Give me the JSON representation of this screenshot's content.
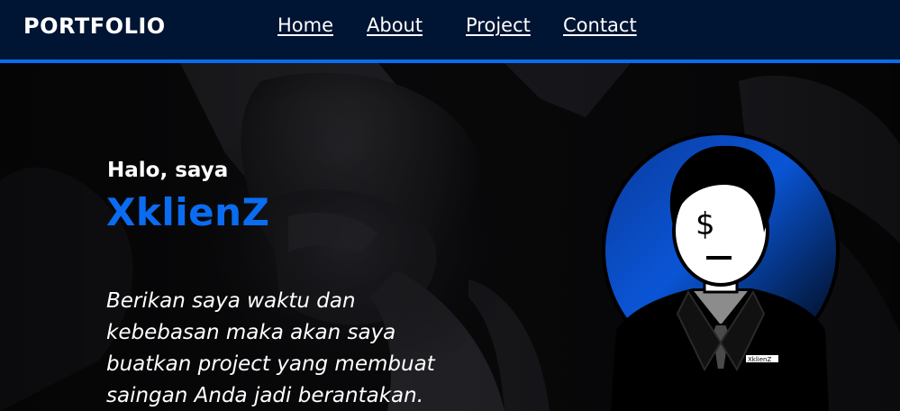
{
  "navbar": {
    "brand": "PORTFOLIO",
    "links": [
      {
        "label": "Home"
      },
      {
        "label": "About"
      },
      {
        "label": "Project"
      },
      {
        "label": "Contact"
      }
    ]
  },
  "hero": {
    "greeting": "Halo, saya",
    "name": "XklienZ",
    "tagline_lines": [
      "Berikan saya waktu dan",
      "kebebasan maka akan saya",
      "buatkan project yang membuat",
      "saingan Anda jadi berantakan."
    ],
    "avatar": {
      "face_symbol": "$",
      "badge_text": "XklienZ"
    }
  },
  "colors": {
    "navbar_bg": "#001433",
    "accent": "#0a6cf1",
    "text": "#ffffff",
    "hero_bg": "#0b0b0d"
  },
  "icons": [
    "avatar-illustration"
  ]
}
